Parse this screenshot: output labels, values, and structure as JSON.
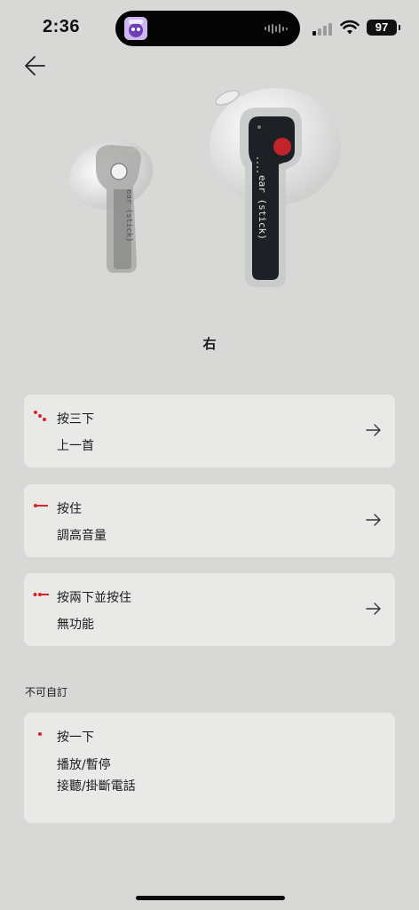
{
  "status_bar": {
    "time": "2:36",
    "battery": "97"
  },
  "earbuds": {
    "left_label": "ear (stick)",
    "right_label": "ear (stick)"
  },
  "side_label": "右",
  "customizable": [
    {
      "title": "按三下",
      "action": "上一首",
      "gesture": "triple-tap"
    },
    {
      "title": "按住",
      "action": "調高音量",
      "gesture": "press-hold"
    },
    {
      "title": "按兩下並按住",
      "action": "無功能",
      "gesture": "double-tap-hold"
    }
  ],
  "fixed_section": {
    "heading": "不可自訂",
    "title": "按一下",
    "actions": [
      "播放/暫停",
      "接聽/掛斷電話"
    ],
    "gesture": "single-tap"
  },
  "colors": {
    "background": "#d8d9d7",
    "card": "#e9eae8",
    "accent_red": "#d8232a"
  }
}
